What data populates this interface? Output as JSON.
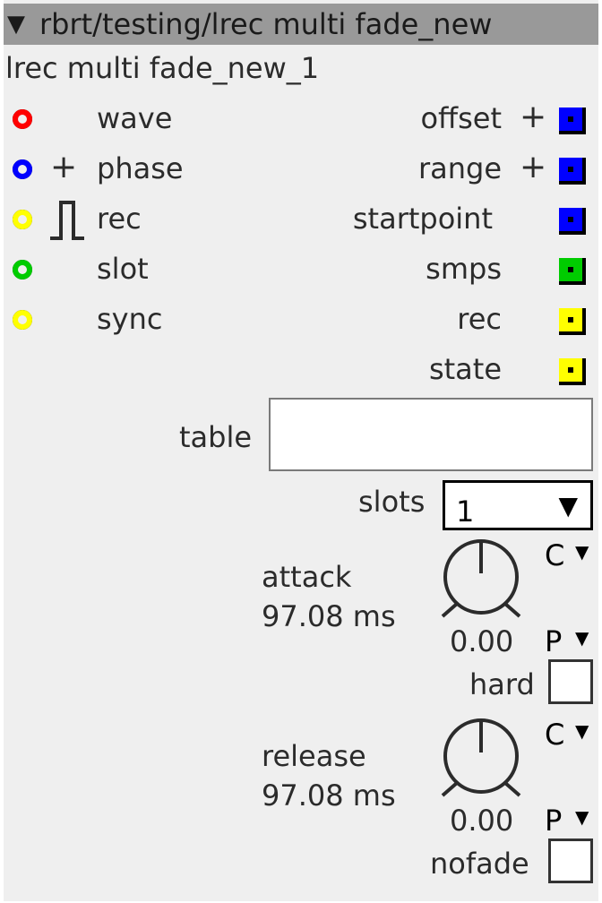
{
  "titlebar": {
    "arrow": "▼",
    "title": "rbrt/testing/lrec multi fade_new"
  },
  "instance_name": "lrec multi fade_new_1",
  "inlets": [
    {
      "label": "wave",
      "color": "#ff0000"
    },
    {
      "label": "phase",
      "color": "#0000ff",
      "modifier": "+"
    },
    {
      "label": "rec",
      "color": "#ffff00",
      "modifier": "⎍"
    },
    {
      "label": "slot",
      "color": "#00cc00"
    },
    {
      "label": "sync",
      "color": "#ffff00"
    }
  ],
  "outlets": [
    {
      "label": "offset",
      "color": "#0000ff",
      "modifier": "+"
    },
    {
      "label": "range",
      "color": "#0000ff",
      "modifier": "+"
    },
    {
      "label": "startpoint",
      "color": "#0000ff"
    },
    {
      "label": "smps",
      "color": "#00cc00"
    },
    {
      "label": "rec",
      "color": "#ffff00"
    },
    {
      "label": "state",
      "color": "#ffff00"
    }
  ],
  "table": {
    "label": "table",
    "value": ""
  },
  "slots": {
    "label": "slots",
    "value": "1",
    "arrow": "▼"
  },
  "attack": {
    "label": "attack",
    "display": "97.08 ms",
    "knob_value": "0.00",
    "c_label": "C",
    "p_label": "P",
    "caret": "▼"
  },
  "hard": {
    "label": "hard",
    "checked": false
  },
  "release": {
    "label": "release",
    "display": "97.08 ms",
    "knob_value": "0.00",
    "c_label": "C",
    "p_label": "P",
    "caret": "▼"
  },
  "nofade": {
    "label": "nofade",
    "checked": false
  }
}
